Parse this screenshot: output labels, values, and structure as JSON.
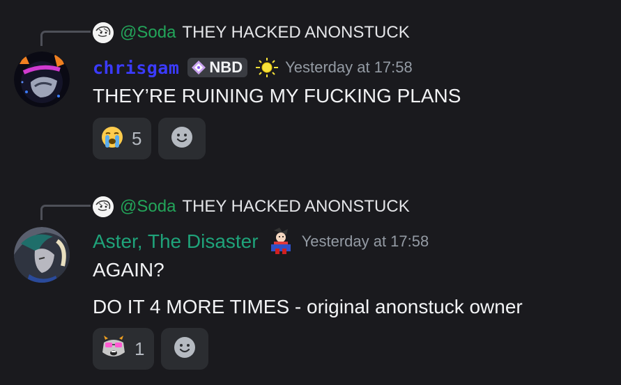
{
  "messages": [
    {
      "reply": {
        "author": "@Soda",
        "text": "THEY HACKED ANONSTUCK",
        "avatar_icon": "sketch-avatar-icon"
      },
      "author": "chrisgam",
      "author_color": "#3b3bff",
      "tag": {
        "label": "NBD",
        "icon": "diamond-sparkle-icon"
      },
      "role_icon": "sun-icon",
      "timestamp": "Yesterday at 17:58",
      "lines": [
        "THEY’RE RUINING MY FUCKING PLANS"
      ],
      "reactions": [
        {
          "emoji": "crying-face-emoji",
          "count": "5"
        }
      ],
      "add_reaction_icon": "smile-add-reaction-icon"
    },
    {
      "reply": {
        "author": "@Soda",
        "text": "THEY HACKED ANONSTUCK",
        "avatar_icon": "sketch-avatar-icon"
      },
      "author": "Aster, The Disaster",
      "author_color": "#1fa37a",
      "role_icon": "character-sprite-icon",
      "timestamp": "Yesterday at 17:58",
      "lines": [
        "AGAIN?",
        "DO IT 4 MORE TIMES - original anonstuck owner"
      ],
      "reactions": [
        {
          "emoji": "troll-face-emoji",
          "count": "1"
        }
      ],
      "add_reaction_icon": "smile-add-reaction-icon"
    }
  ],
  "colors": {
    "background": "#1a1a1e",
    "reply_name": "#23a55a",
    "timestamp": "#949ba4",
    "reaction_bg": "#2b2d31"
  }
}
